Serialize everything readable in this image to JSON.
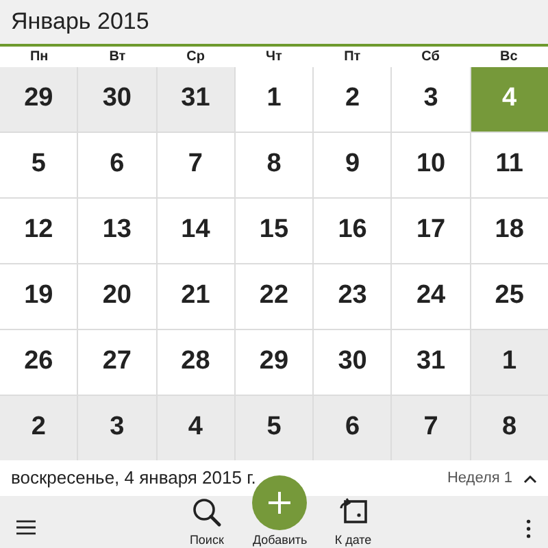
{
  "header": {
    "title": "Январь 2015"
  },
  "weekdays": [
    "Пн",
    "Вт",
    "Ср",
    "Чт",
    "Пт",
    "Сб",
    "Вс"
  ],
  "weeks": [
    [
      {
        "label": "29",
        "outside": true,
        "selected": false
      },
      {
        "label": "30",
        "outside": true,
        "selected": false
      },
      {
        "label": "31",
        "outside": true,
        "selected": false
      },
      {
        "label": "1",
        "outside": false,
        "selected": false
      },
      {
        "label": "2",
        "outside": false,
        "selected": false
      },
      {
        "label": "3",
        "outside": false,
        "selected": false
      },
      {
        "label": "4",
        "outside": false,
        "selected": true
      }
    ],
    [
      {
        "label": "5",
        "outside": false,
        "selected": false
      },
      {
        "label": "6",
        "outside": false,
        "selected": false
      },
      {
        "label": "7",
        "outside": false,
        "selected": false
      },
      {
        "label": "8",
        "outside": false,
        "selected": false
      },
      {
        "label": "9",
        "outside": false,
        "selected": false
      },
      {
        "label": "10",
        "outside": false,
        "selected": false
      },
      {
        "label": "11",
        "outside": false,
        "selected": false
      }
    ],
    [
      {
        "label": "12",
        "outside": false,
        "selected": false
      },
      {
        "label": "13",
        "outside": false,
        "selected": false
      },
      {
        "label": "14",
        "outside": false,
        "selected": false
      },
      {
        "label": "15",
        "outside": false,
        "selected": false
      },
      {
        "label": "16",
        "outside": false,
        "selected": false
      },
      {
        "label": "17",
        "outside": false,
        "selected": false
      },
      {
        "label": "18",
        "outside": false,
        "selected": false
      }
    ],
    [
      {
        "label": "19",
        "outside": false,
        "selected": false
      },
      {
        "label": "20",
        "outside": false,
        "selected": false
      },
      {
        "label": "21",
        "outside": false,
        "selected": false
      },
      {
        "label": "22",
        "outside": false,
        "selected": false
      },
      {
        "label": "23",
        "outside": false,
        "selected": false
      },
      {
        "label": "24",
        "outside": false,
        "selected": false
      },
      {
        "label": "25",
        "outside": false,
        "selected": false
      }
    ],
    [
      {
        "label": "26",
        "outside": false,
        "selected": false
      },
      {
        "label": "27",
        "outside": false,
        "selected": false
      },
      {
        "label": "28",
        "outside": false,
        "selected": false
      },
      {
        "label": "29",
        "outside": false,
        "selected": false
      },
      {
        "label": "30",
        "outside": false,
        "selected": false
      },
      {
        "label": "31",
        "outside": false,
        "selected": false
      },
      {
        "label": "1",
        "outside": true,
        "selected": false
      }
    ],
    [
      {
        "label": "2",
        "outside": true,
        "selected": false
      },
      {
        "label": "3",
        "outside": true,
        "selected": false
      },
      {
        "label": "4",
        "outside": true,
        "selected": false
      },
      {
        "label": "5",
        "outside": true,
        "selected": false
      },
      {
        "label": "6",
        "outside": true,
        "selected": false
      },
      {
        "label": "7",
        "outside": true,
        "selected": false
      },
      {
        "label": "8",
        "outside": true,
        "selected": false
      }
    ]
  ],
  "date_bar": {
    "date": "воскресенье, 4 января 2015 г.",
    "week": "Неделя 1"
  },
  "toolbar": [
    {
      "kind": "menu"
    },
    {
      "kind": "search",
      "label": "Поиск"
    },
    {
      "kind": "add",
      "label": "Добавить"
    },
    {
      "kind": "goto",
      "label": "К дате"
    },
    {
      "kind": "more"
    }
  ]
}
